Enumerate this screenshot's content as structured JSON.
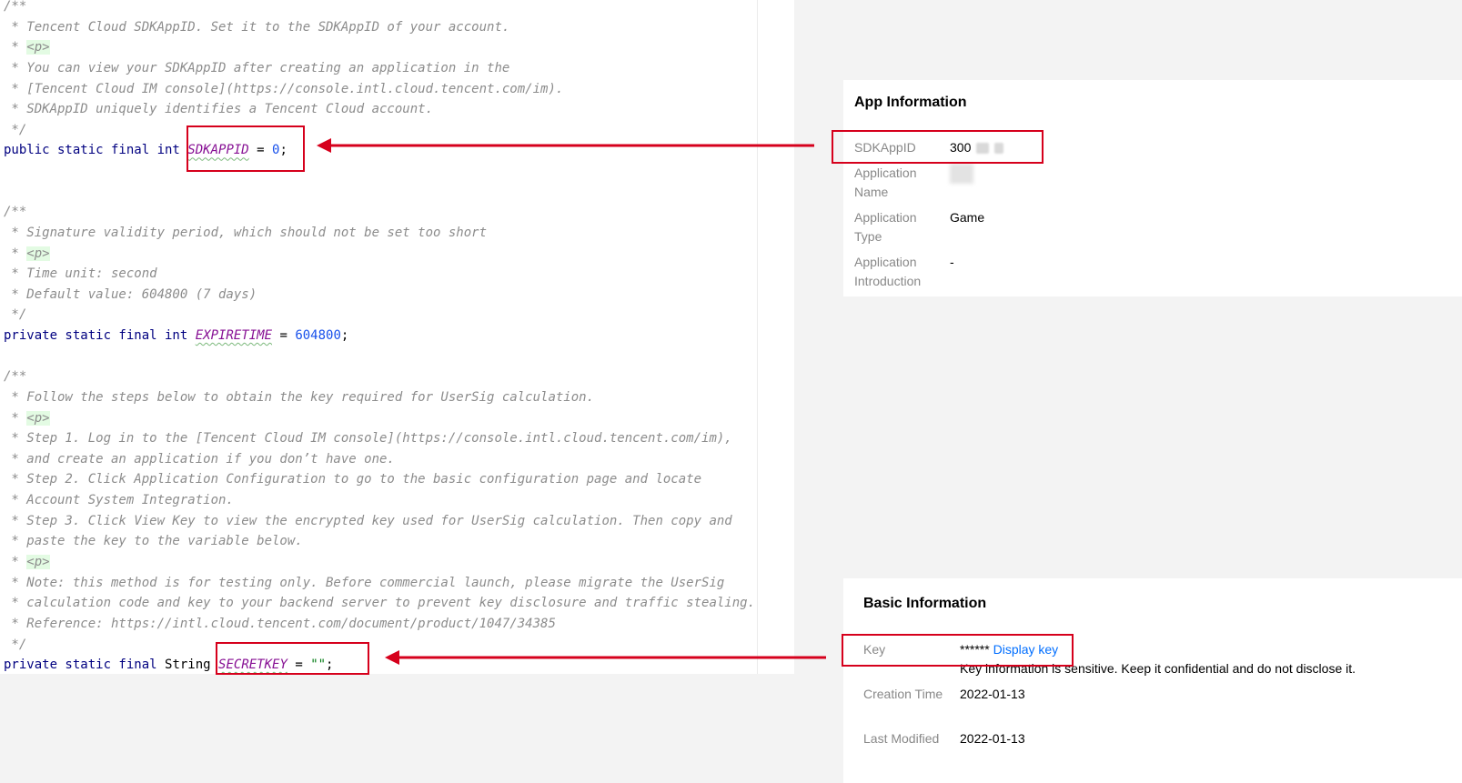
{
  "code": {
    "lines": [
      {
        "parts": [
          {
            "t": "/**",
            "c": "cm"
          }
        ]
      },
      {
        "parts": [
          {
            "t": " * Tencent Cloud SDKAppID. Set it to the SDKAppID of your account.",
            "c": "cm"
          }
        ]
      },
      {
        "parts": [
          {
            "t": " * ",
            "c": "cm"
          },
          {
            "t": "<p>",
            "c": "tag"
          }
        ]
      },
      {
        "parts": [
          {
            "t": " * You can view your SDKAppID after creating an application in the",
            "c": "cm"
          }
        ]
      },
      {
        "parts": [
          {
            "t": " * [Tencent Cloud IM console](https://console.intl.cloud.tencent.com/im).",
            "c": "cm"
          }
        ]
      },
      {
        "parts": [
          {
            "t": " * SDKAppID uniquely identifies a Tencent Cloud account.",
            "c": "cm"
          }
        ]
      },
      {
        "parts": [
          {
            "t": " */",
            "c": "cm"
          }
        ]
      },
      {
        "parts": [
          {
            "t": "public static final int ",
            "c": "kw"
          },
          {
            "t": "SDKAPPID",
            "c": "const"
          },
          {
            "t": " = ",
            "c": "plain"
          },
          {
            "t": "0",
            "c": "num"
          },
          {
            "t": ";",
            "c": "plain"
          }
        ]
      },
      {
        "parts": []
      },
      {
        "parts": []
      },
      {
        "parts": [
          {
            "t": "/**",
            "c": "cm"
          }
        ]
      },
      {
        "parts": [
          {
            "t": " * Signature validity period, which should not be set too short",
            "c": "cm"
          }
        ]
      },
      {
        "parts": [
          {
            "t": " * ",
            "c": "cm"
          },
          {
            "t": "<p>",
            "c": "tag"
          }
        ]
      },
      {
        "parts": [
          {
            "t": " * Time unit: second",
            "c": "cm"
          }
        ]
      },
      {
        "parts": [
          {
            "t": " * Default value: 604800 (7 days)",
            "c": "cm"
          }
        ]
      },
      {
        "parts": [
          {
            "t": " */",
            "c": "cm"
          }
        ]
      },
      {
        "parts": [
          {
            "t": "private static final int ",
            "c": "kw"
          },
          {
            "t": "EXPIRETIME",
            "c": "const"
          },
          {
            "t": " = ",
            "c": "plain"
          },
          {
            "t": "604800",
            "c": "num"
          },
          {
            "t": ";",
            "c": "plain"
          }
        ]
      },
      {
        "parts": []
      },
      {
        "parts": [
          {
            "t": "/**",
            "c": "cm"
          }
        ]
      },
      {
        "parts": [
          {
            "t": " * Follow the steps below to obtain the key required for UserSig calculation.",
            "c": "cm"
          }
        ]
      },
      {
        "parts": [
          {
            "t": " * ",
            "c": "cm"
          },
          {
            "t": "<p>",
            "c": "tag"
          }
        ]
      },
      {
        "parts": [
          {
            "t": " * Step 1. Log in to the [Tencent Cloud IM console](https://console.intl.cloud.tencent.com/im),",
            "c": "cm"
          }
        ]
      },
      {
        "parts": [
          {
            "t": " * and create an application if you don’t have one.",
            "c": "cm"
          }
        ]
      },
      {
        "parts": [
          {
            "t": " * Step 2. Click Application Configuration to go to the basic configuration page and locate",
            "c": "cm"
          }
        ]
      },
      {
        "parts": [
          {
            "t": " * Account System Integration.",
            "c": "cm"
          }
        ]
      },
      {
        "parts": [
          {
            "t": " * Step 3. Click View Key to view the encrypted key used for UserSig calculation. Then copy and",
            "c": "cm"
          }
        ]
      },
      {
        "parts": [
          {
            "t": " * paste the key to the variable below.",
            "c": "cm"
          }
        ]
      },
      {
        "parts": [
          {
            "t": " * ",
            "c": "cm"
          },
          {
            "t": "<p>",
            "c": "tag"
          }
        ]
      },
      {
        "parts": [
          {
            "t": " * Note: this method is for testing only. Before commercial launch, please migrate the UserSig",
            "c": "cm"
          }
        ]
      },
      {
        "parts": [
          {
            "t": " * calculation code and key to your backend server to prevent key disclosure and traffic stealing.",
            "c": "cm"
          }
        ]
      },
      {
        "parts": [
          {
            "t": " * Reference: https://intl.cloud.tencent.com/document/product/1047/34385",
            "c": "cm"
          }
        ]
      },
      {
        "parts": [
          {
            "t": " */",
            "c": "cm"
          }
        ]
      },
      {
        "parts": [
          {
            "t": "private static final ",
            "c": "kw"
          },
          {
            "t": "String ",
            "c": "plain"
          },
          {
            "t": "SECRETKEY",
            "c": "const"
          },
          {
            "t": " = ",
            "c": "plain"
          },
          {
            "t": "\"\"",
            "c": "str"
          },
          {
            "t": ";",
            "c": "plain"
          }
        ]
      }
    ]
  },
  "app_info": {
    "title": "App Information",
    "sdkappid_label": "SDKAppID",
    "sdkappid_value": "300",
    "app_name_label": "Application Name",
    "app_type_label": "Application Type",
    "app_type_value": "Game",
    "app_intro_label": "Application Introduction",
    "app_intro_value": "-"
  },
  "basic_info": {
    "title": "Basic Information",
    "key_label": "Key",
    "key_masked": "******",
    "display_key_link": "Display key",
    "key_note": "Key information is sensitive. Keep it confidential and do not disclose it.",
    "creation_label": "Creation Time",
    "creation_value": "2022-01-13",
    "modified_label": "Last Modified",
    "modified_value": "2022-01-13"
  },
  "colors": {
    "annotation_red": "#d6001c",
    "link_blue": "#006eff"
  }
}
